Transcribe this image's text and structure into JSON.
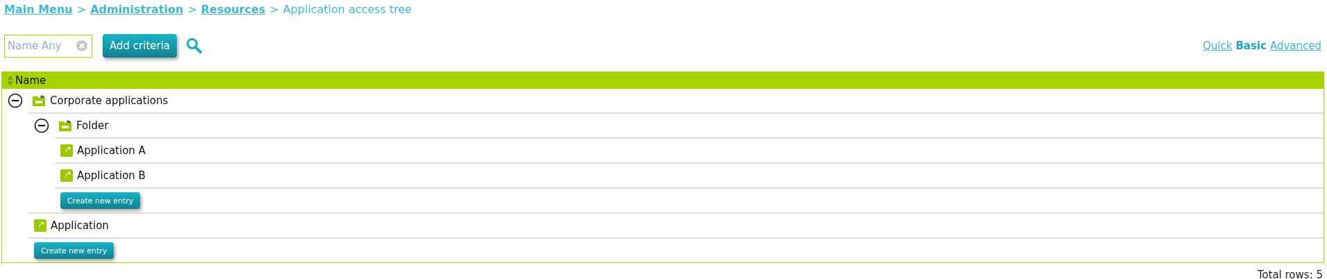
{
  "breadcrumb_separator": ">",
  "breadcrumb": [
    {
      "label": "Main Menu",
      "link": true
    },
    {
      "label": "Administration",
      "link": true
    },
    {
      "label": "Resources",
      "link": true
    },
    {
      "label": "Application access tree",
      "link": false
    }
  ],
  "search": {
    "placeholder": "Name Any"
  },
  "add_criteria_button": "Add criteria",
  "modes": [
    {
      "label": "Quick",
      "selected": false
    },
    {
      "label": "Basic",
      "selected": true
    },
    {
      "label": "Advanced",
      "selected": false
    }
  ],
  "table": {
    "columns": [
      "Name"
    ],
    "tree": [
      {
        "kind": "folder",
        "label": "Corporate applications",
        "expanded": true,
        "children": [
          {
            "kind": "folder",
            "label": "Folder",
            "expanded": true,
            "children": [
              {
                "kind": "app",
                "label": "Application A"
              },
              {
                "kind": "app",
                "label": "Application B"
              },
              {
                "kind": "create",
                "label": "Create new entry"
              }
            ]
          },
          {
            "kind": "app",
            "label": "Application"
          },
          {
            "kind": "create",
            "label": "Create new entry"
          }
        ]
      }
    ]
  },
  "total_rows": "Total rows: 5"
}
